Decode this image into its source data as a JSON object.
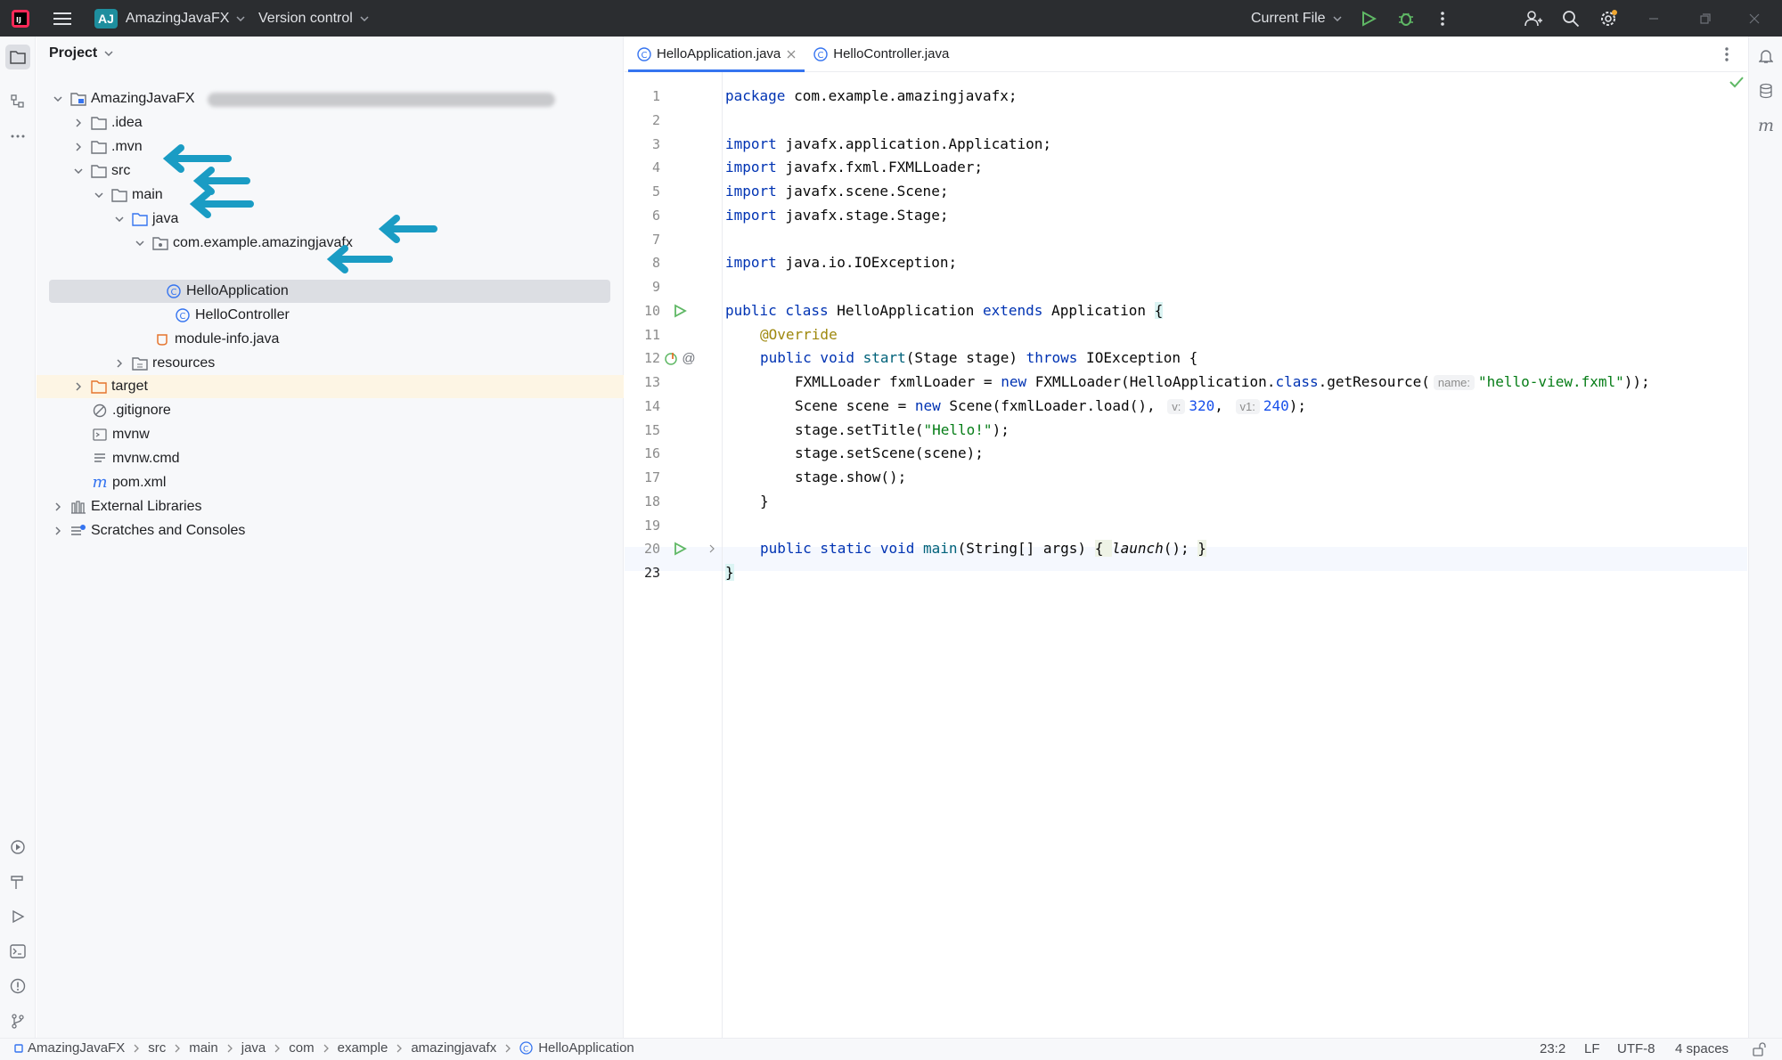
{
  "titlebar": {
    "app_badge": "AJ",
    "project_name": "AmazingJavaFX",
    "vcs_label": "Version control",
    "run_config": "Current File"
  },
  "project_panel": {
    "title": "Project",
    "tree": [
      {
        "label": "AmazingJavaFX",
        "icon": "module-folder-icon",
        "expanded": true
      },
      {
        "label": ".idea",
        "icon": "folder-icon",
        "expanded": false
      },
      {
        "label": ".mvn",
        "icon": "folder-icon",
        "expanded": false
      },
      {
        "label": "src",
        "icon": "folder-icon",
        "expanded": true
      },
      {
        "label": "main",
        "icon": "folder-icon",
        "expanded": true
      },
      {
        "label": "java",
        "icon": "source-folder-icon",
        "expanded": true
      },
      {
        "label": "com.example.amazingjavafx",
        "icon": "package-icon",
        "expanded": true
      },
      {
        "label": "HelloApplication",
        "icon": "class-icon",
        "selected": true
      },
      {
        "label": "HelloController",
        "icon": "class-icon"
      },
      {
        "label": "module-info.java",
        "icon": "java-module-icon"
      },
      {
        "label": "resources",
        "icon": "folder-icon",
        "expanded": false
      },
      {
        "label": "target",
        "icon": "excluded-folder-icon",
        "expanded": false
      },
      {
        "label": ".gitignore",
        "icon": "ignore-file-icon"
      },
      {
        "label": "mvnw",
        "icon": "script-icon"
      },
      {
        "label": "mvnw.cmd",
        "icon": "text-file-icon"
      },
      {
        "label": "pom.xml",
        "icon": "maven-icon"
      },
      {
        "label": "External Libraries",
        "icon": "library-icon",
        "expanded": false
      },
      {
        "label": "Scratches and Consoles",
        "icon": "scratches-icon",
        "expanded": false
      }
    ]
  },
  "editor": {
    "tabs": [
      {
        "label": "HelloApplication.java",
        "active": true
      },
      {
        "label": "HelloController.java",
        "active": false
      }
    ],
    "line_numbers": [
      "1",
      "2",
      "3",
      "4",
      "5",
      "6",
      "7",
      "8",
      "9",
      "10",
      "11",
      "12",
      "13",
      "14",
      "15",
      "16",
      "17",
      "18",
      "19",
      "20",
      "23"
    ],
    "code": {
      "l1_kw": "package",
      "l1_rest": " com.example.amazingjavafx;",
      "l3_kw": "import",
      "l3_rest": " javafx.application.Application;",
      "l4_kw": "import",
      "l4_rest": " javafx.fxml.FXMLLoader;",
      "l5_kw": "import",
      "l5_rest": " javafx.scene.Scene;",
      "l6_kw": "import",
      "l6_rest": " javafx.stage.Stage;",
      "l8_kw": "import",
      "l8_rest": " java.io.IOException;",
      "l10_kw1": "public class",
      "l10_mid": " HelloApplication ",
      "l10_kw2": "extends",
      "l10_rest": " Application ",
      "l10_brace": "{",
      "l11_ann": "@Override",
      "l12_kw1": "public void",
      "l12_m": " start",
      "l12_mid": "(Stage stage) ",
      "l12_kw2": "throws",
      "l12_rest": " IOException {",
      "l13_a": "FXMLLoader fxmlLoader = ",
      "l13_kw": "new",
      "l13_b": " FXMLLoader(HelloApplication.",
      "l13_kw2": "class",
      "l13_c": ".getResource(",
      "l13_hint": "name:",
      "l13_str": "\"hello-view.fxml\"",
      "l13_d": "));",
      "l14_a": "Scene scene = ",
      "l14_kw": "new",
      "l14_b": " Scene(fxmlLoader.load(), ",
      "l14_hint1": "v:",
      "l14_n1": "320",
      "l14_c": ", ",
      "l14_hint2": "v1:",
      "l14_n2": "240",
      "l14_d": ");",
      "l15_a": "stage.setTitle(",
      "l15_str": "\"Hello!\"",
      "l15_b": ");",
      "l16": "stage.setScene(scene);",
      "l17": "stage.show();",
      "l18": "}",
      "l20_kw": "public static void",
      "l20_m": " main",
      "l20_mid": "(String[] args) ",
      "l20_b1": "{ ",
      "l20_call": "launch",
      "l20_rest": "(); ",
      "l20_b2": "}",
      "l23": "}"
    }
  },
  "statusbar": {
    "breadcrumbs": [
      "AmazingJavaFX",
      "src",
      "main",
      "java",
      "com",
      "example",
      "amazingjavafx",
      "HelloApplication"
    ],
    "caret": "23:2",
    "line_sep": "LF",
    "encoding": "UTF-8",
    "indent": "4 spaces"
  },
  "colors": {
    "annotation_arrow": "#1a9cc4",
    "selection": "#dcdee3",
    "excluded_highlight": "#fdf5e4",
    "keyword": "#0033b3",
    "string": "#067d17"
  }
}
